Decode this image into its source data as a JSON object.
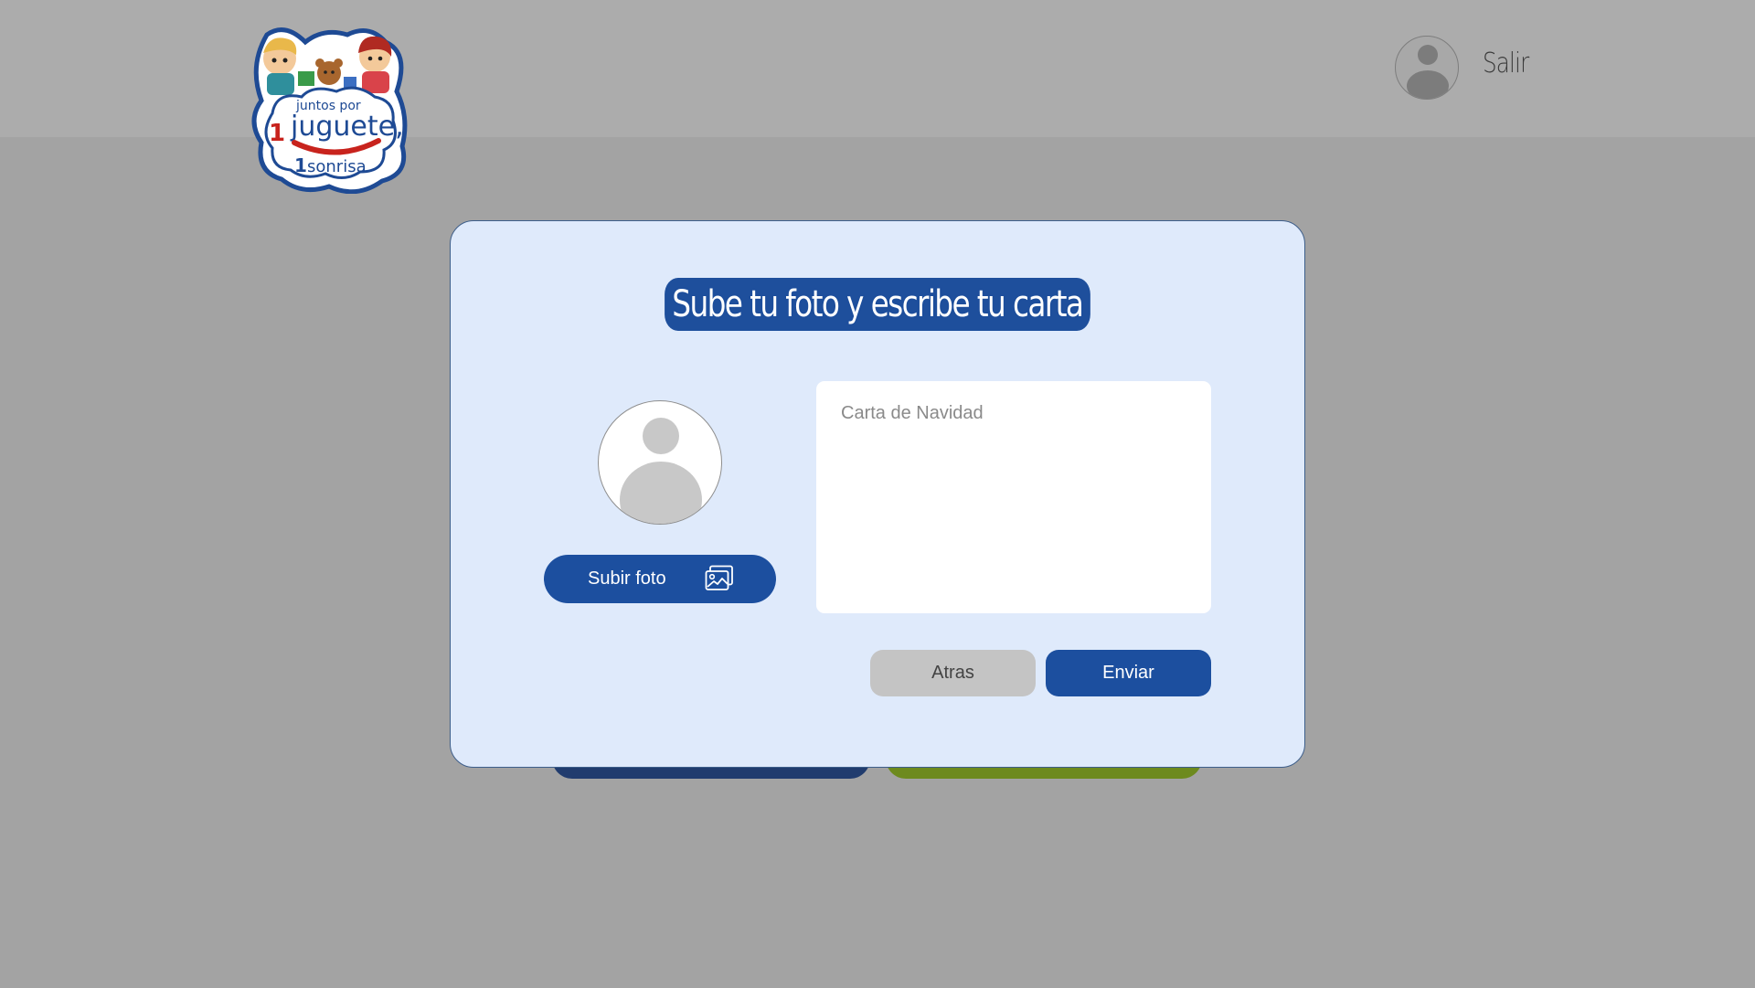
{
  "header": {
    "logo": {
      "line1": "juntos por",
      "num1": "1",
      "line2": "juguete,",
      "num2": "1",
      "line3": "sonrisa"
    },
    "logout_label": "Salir",
    "user_icon": "user-avatar-icon"
  },
  "modal": {
    "title": "Sube tu foto y escribe tu carta",
    "upload_button_label": "Subir foto",
    "upload_icon": "image-gallery-icon",
    "photo_placeholder_icon": "user-avatar-icon",
    "letter_placeholder": "Carta de Navidad",
    "letter_value": "",
    "back_button_label": "Atras",
    "send_button_label": "Enviar"
  },
  "colors": {
    "brand_blue": "#1c4f9f",
    "modal_bg": "#dfeafb",
    "overlay": "#a3a3a3",
    "back_button": "#c4c4c4",
    "bg_green_button": "#6d8a1e"
  }
}
